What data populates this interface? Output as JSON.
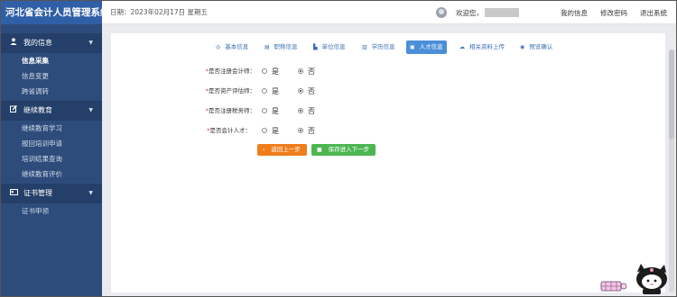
{
  "app": {
    "title": "河北省会计人员管理系统"
  },
  "header": {
    "date_label": "日期：",
    "date_value": "2023年02月17日 星期五",
    "welcome": "欢迎您，",
    "links": [
      "我的信息",
      "修改密码",
      "退出系统"
    ]
  },
  "sidebar": {
    "groups": [
      {
        "label": "我的信息",
        "icon": "user-icon",
        "items": [
          "信息采集",
          "信息变更",
          "跨省调转"
        ],
        "active": "信息采集"
      },
      {
        "label": "继续教育",
        "icon": "edit-icon",
        "items": [
          "继续教育学习",
          "报回培训申请",
          "培训结果查询",
          "继续教育评价"
        ]
      },
      {
        "label": "证书管理",
        "icon": "card-icon",
        "items": [
          "证书申领"
        ]
      }
    ]
  },
  "tabs": [
    {
      "label": "基本信息",
      "icon": "target-icon"
    },
    {
      "label": "职称信息",
      "icon": "id-card-icon"
    },
    {
      "label": "单位信息",
      "icon": "building-icon"
    },
    {
      "label": "学历信息",
      "icon": "book-icon"
    },
    {
      "label": "人才信息",
      "icon": "briefcase-icon",
      "active": true
    },
    {
      "label": "相关资料上传",
      "icon": "cloud-upload-icon"
    },
    {
      "label": "预览确认",
      "icon": "eye-check-icon"
    }
  ],
  "form": {
    "required_mark": "*",
    "fields": [
      {
        "label": "是否注册会计师：",
        "required": true,
        "options": [
          "是",
          "否"
        ],
        "selected": "否"
      },
      {
        "label": "是否资产评估师：",
        "required": true,
        "options": [
          "是",
          "否"
        ],
        "selected": "否"
      },
      {
        "label": "是否注册税务师：",
        "required": true,
        "options": [
          "是",
          "否"
        ],
        "selected": "否"
      },
      {
        "label": "是否会计人才：",
        "required": true,
        "options": [
          "是",
          "否"
        ],
        "selected": "否"
      }
    ],
    "prev_button": "返回上一步",
    "next_button": "保存进入下一步"
  },
  "colors": {
    "sidebar": "#2d4c7c",
    "brand": "#2f5fa6",
    "active_tab": "#4a8fd8",
    "prev": "#f07d1b",
    "next": "#4db653"
  }
}
